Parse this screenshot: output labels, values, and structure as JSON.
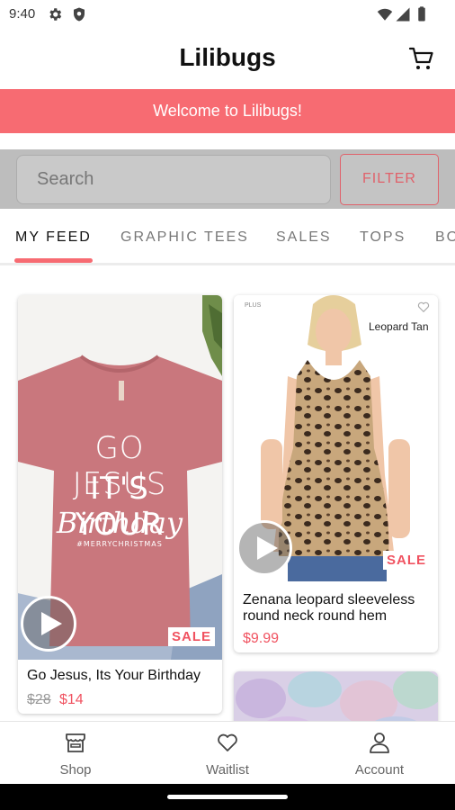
{
  "status_bar": {
    "time": "9:40"
  },
  "app_bar": {
    "title": "Lilibugs"
  },
  "banner": {
    "text": "Welcome to Lilibugs!"
  },
  "search": {
    "placeholder": "Search",
    "filter_label": "FILTER"
  },
  "tabs": [
    {
      "label": "MY FEED",
      "active": true
    },
    {
      "label": "GRAPHIC TEES"
    },
    {
      "label": "SALES"
    },
    {
      "label": "TOPS"
    },
    {
      "label": "BO"
    }
  ],
  "products": [
    {
      "name": "Go Jesus, Its Your Birthday",
      "old_price": "$28",
      "price": "$14",
      "badge": "SALE",
      "shirt_text": {
        "line1": "GO JESUS",
        "line2": "IT'S YOUR",
        "line3": "Birthday",
        "tag": "#MERRYCHRISTMAS"
      }
    },
    {
      "name": "Zenana leopard sleeveless round neck round hem",
      "price": "$9.99",
      "badge": "SALE",
      "overlay_label": "Leopard Tan",
      "corner_mark": "PLUS"
    }
  ],
  "bottom_nav": [
    {
      "label": "Shop",
      "icon": "storefront-icon"
    },
    {
      "label": "Waitlist",
      "icon": "heart-icon"
    },
    {
      "label": "Account",
      "icon": "person-icon"
    }
  ],
  "colors": {
    "accent": "#f76b72",
    "sale_red": "#f05260"
  }
}
